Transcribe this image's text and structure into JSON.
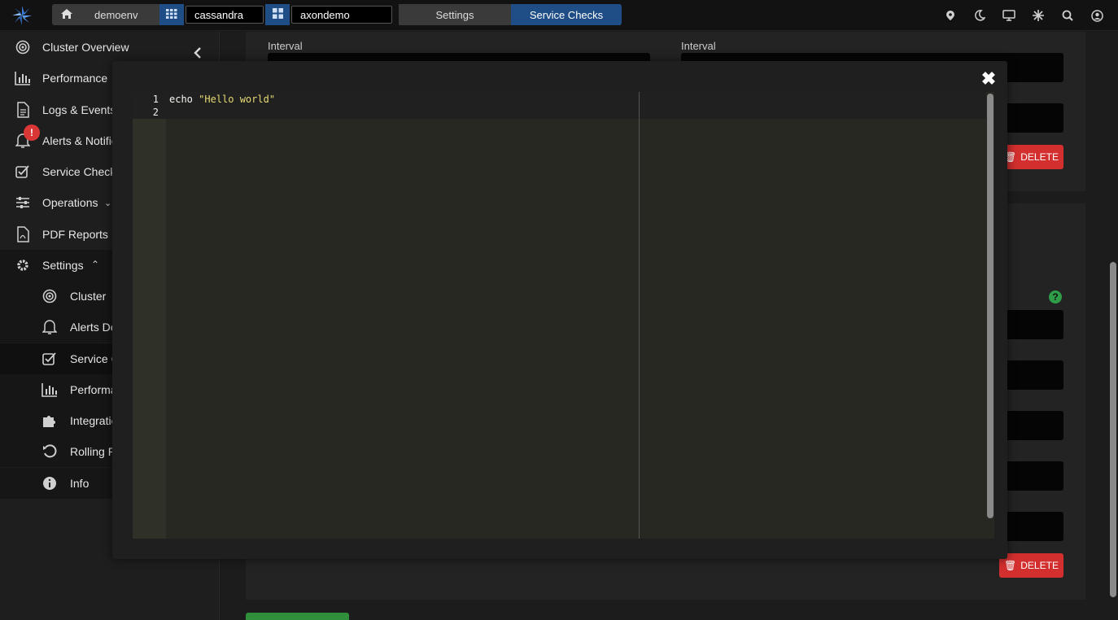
{
  "topbar": {
    "breadcrumbs": {
      "env": "demoenv",
      "cluster": "cassandra",
      "org": "axondemo",
      "settings": "Settings",
      "current": "Service Checks"
    }
  },
  "sidebar": {
    "items": [
      {
        "label": "Cluster Overview",
        "icon": "target-icon"
      },
      {
        "label": "Performance",
        "icon": "bar-chart-icon"
      },
      {
        "label": "Logs & Events",
        "icon": "document-icon"
      },
      {
        "label": "Alerts & Notific",
        "icon": "bell-icon"
      },
      {
        "label": "Service Check",
        "icon": "check-square-icon",
        "badge": "!"
      },
      {
        "label": "Operations",
        "icon": "sliders-icon"
      },
      {
        "label": "PDF Reports",
        "icon": "pdf-icon"
      },
      {
        "label": "Settings",
        "icon": "gear-icon"
      }
    ],
    "sub_items": [
      {
        "label": "Cluster",
        "icon": "target-icon"
      },
      {
        "label": "Alerts De",
        "icon": "bell-icon"
      },
      {
        "label": "Service C",
        "icon": "check-square-icon"
      },
      {
        "label": "Performa",
        "icon": "bar-chart-icon"
      },
      {
        "label": "Integratio",
        "icon": "puzzle-icon"
      },
      {
        "label": "Rolling R",
        "icon": "restart-icon"
      },
      {
        "label": "Info",
        "icon": "info-icon"
      }
    ]
  },
  "background": {
    "interval_label_left": "Interval",
    "interval_label_right": "Interval",
    "delete_label": "DELETE"
  },
  "editor": {
    "line_numbers": [
      "1",
      "2"
    ],
    "line1_cmd": "echo ",
    "line1_string": "\"Hello world\""
  },
  "colors": {
    "accent_blue": "#1f4e86",
    "danger": "#d32f2f",
    "editor_bg": "#272822",
    "string": "#e6db74"
  }
}
